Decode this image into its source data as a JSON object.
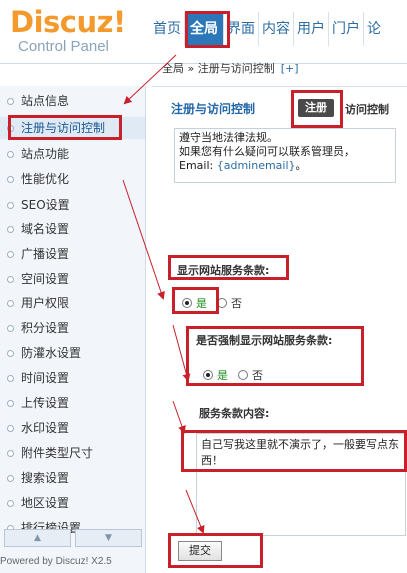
{
  "header": {
    "brand": "Discuz!",
    "subtitle": "Control Panel",
    "nav": [
      "首页",
      "全局",
      "界面",
      "内容",
      "用户",
      "门户",
      "论"
    ]
  },
  "breadcrumb": {
    "text": "全局 » 注册与访问控制",
    "plus": "[+]"
  },
  "sidebar": {
    "items": [
      "站点信息",
      "注册与访问控制",
      "站点功能",
      "性能优化",
      "SEO设置",
      "域名设置",
      "广播设置",
      "空间设置",
      "用户权限",
      "积分设置",
      "防灌水设置",
      "时间设置",
      "上传设置",
      "水印设置",
      "附件类型尺寸",
      "搜索设置",
      "地区设置",
      "排行榜设置"
    ],
    "scroll_up": "▲",
    "scroll_down": "▼",
    "powered": "Powered by Discuz! X2.5"
  },
  "main": {
    "title": "注册与访问控制",
    "tab_register": "注册",
    "tab_access": "访问控制",
    "notice": {
      "line1": "遵守当地法律法规。",
      "line2": "如果您有什么疑问可以联系管理员，",
      "email_prefix": "Email: ",
      "email_tag": "{adminemail}",
      "email_suffix": "。"
    },
    "show_terms": {
      "label": "显示网站服务条款:",
      "yes": "是",
      "no": "否"
    },
    "force_terms": {
      "label": "是否强制显示网站服务条款:",
      "yes": "是",
      "no": "否"
    },
    "terms_content": {
      "label": "服务条款内容:",
      "value": "自己写我这里就不演示了，一般要写点东西！"
    },
    "submit": "提交"
  },
  "colors": {
    "annotation": "#c8202b",
    "nav_active": "#2b77b8",
    "title_blue": "#2267a8",
    "brand_orange": "#f49a2c"
  }
}
